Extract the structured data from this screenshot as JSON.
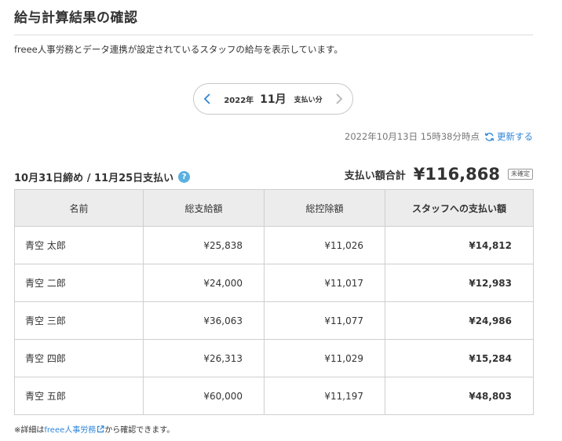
{
  "page": {
    "title": "給与計算結果の確認",
    "description": "freee人事労務とデータ連携が設定されているスタッフの給与を表示しています。"
  },
  "period_nav": {
    "year": "2022年",
    "month": "11月",
    "suffix": "支払い分"
  },
  "update": {
    "timestamp": "2022年10月13日 15時38分時点",
    "refresh_label": "更新する"
  },
  "summary": {
    "period_label": "10月31日締め / 11月25日支払い",
    "help": "?",
    "total_label": "支払い額合計",
    "total_amount": "¥116,868",
    "status": "未確定"
  },
  "table": {
    "headers": [
      "名前",
      "総支給額",
      "総控除額",
      "スタッフへの支払い額"
    ],
    "rows": [
      {
        "name": "青空 太郎",
        "gross": "¥25,838",
        "deduction": "¥11,026",
        "pay": "¥14,812"
      },
      {
        "name": "青空 二郎",
        "gross": "¥24,000",
        "deduction": "¥11,017",
        "pay": "¥12,983"
      },
      {
        "name": "青空 三郎",
        "gross": "¥36,063",
        "deduction": "¥11,077",
        "pay": "¥24,986"
      },
      {
        "name": "青空 四郎",
        "gross": "¥26,313",
        "deduction": "¥11,029",
        "pay": "¥15,284"
      },
      {
        "name": "青空 五郎",
        "gross": "¥60,000",
        "deduction": "¥11,197",
        "pay": "¥48,803"
      }
    ]
  },
  "footnote": {
    "prefix": "※詳細は",
    "link": "freee人事労務",
    "suffix": "から確認できます。"
  },
  "colors": {
    "accent": "#2f86d6",
    "help": "#5bb0e0",
    "header_bg": "#ececec",
    "border": "#cfcfcf"
  }
}
